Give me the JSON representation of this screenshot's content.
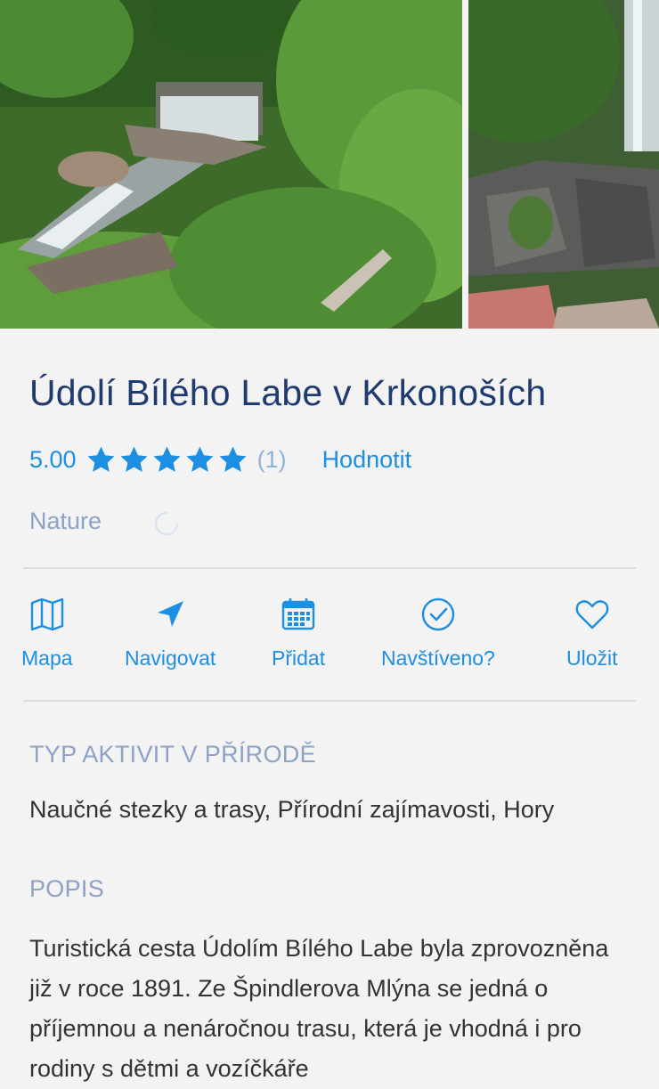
{
  "place": {
    "title": "Údolí Bílého Labe v Krkonoších",
    "rating_value": "5.00",
    "rating_stars": 5,
    "rating_count": "(1)",
    "rate_label": "Hodnotit",
    "category": "Nature"
  },
  "actions": [
    {
      "label": "Mapa",
      "icon": "map-icon"
    },
    {
      "label": "Navigovat",
      "icon": "navigation-arrow-icon"
    },
    {
      "label": "Přidat",
      "icon": "calendar-icon"
    },
    {
      "label": "Navštíveno?",
      "icon": "check-circle-icon"
    },
    {
      "label": "Uložit",
      "icon": "heart-icon"
    }
  ],
  "sections": {
    "activity_heading": "TYP AKTIVIT V PŘÍRODĚ",
    "activity_text": "Naučné stezky a trasy, Přírodní zajímavosti, Hory",
    "description_heading": "POPIS",
    "description_text": "Turistická cesta Údolím Bílého Labe byla zprovozněna již v roce 1891. Ze Špindlerova Mlýna se jedná o příjemnou a nenáročnou trasu, která je vhodná i pro rodiny s dětmi a vozíčkáře"
  },
  "colors": {
    "accent": "#1d8fe3",
    "title": "#1e3a6e",
    "muted": "#8ea2c7",
    "background": "#f3f3f3"
  }
}
